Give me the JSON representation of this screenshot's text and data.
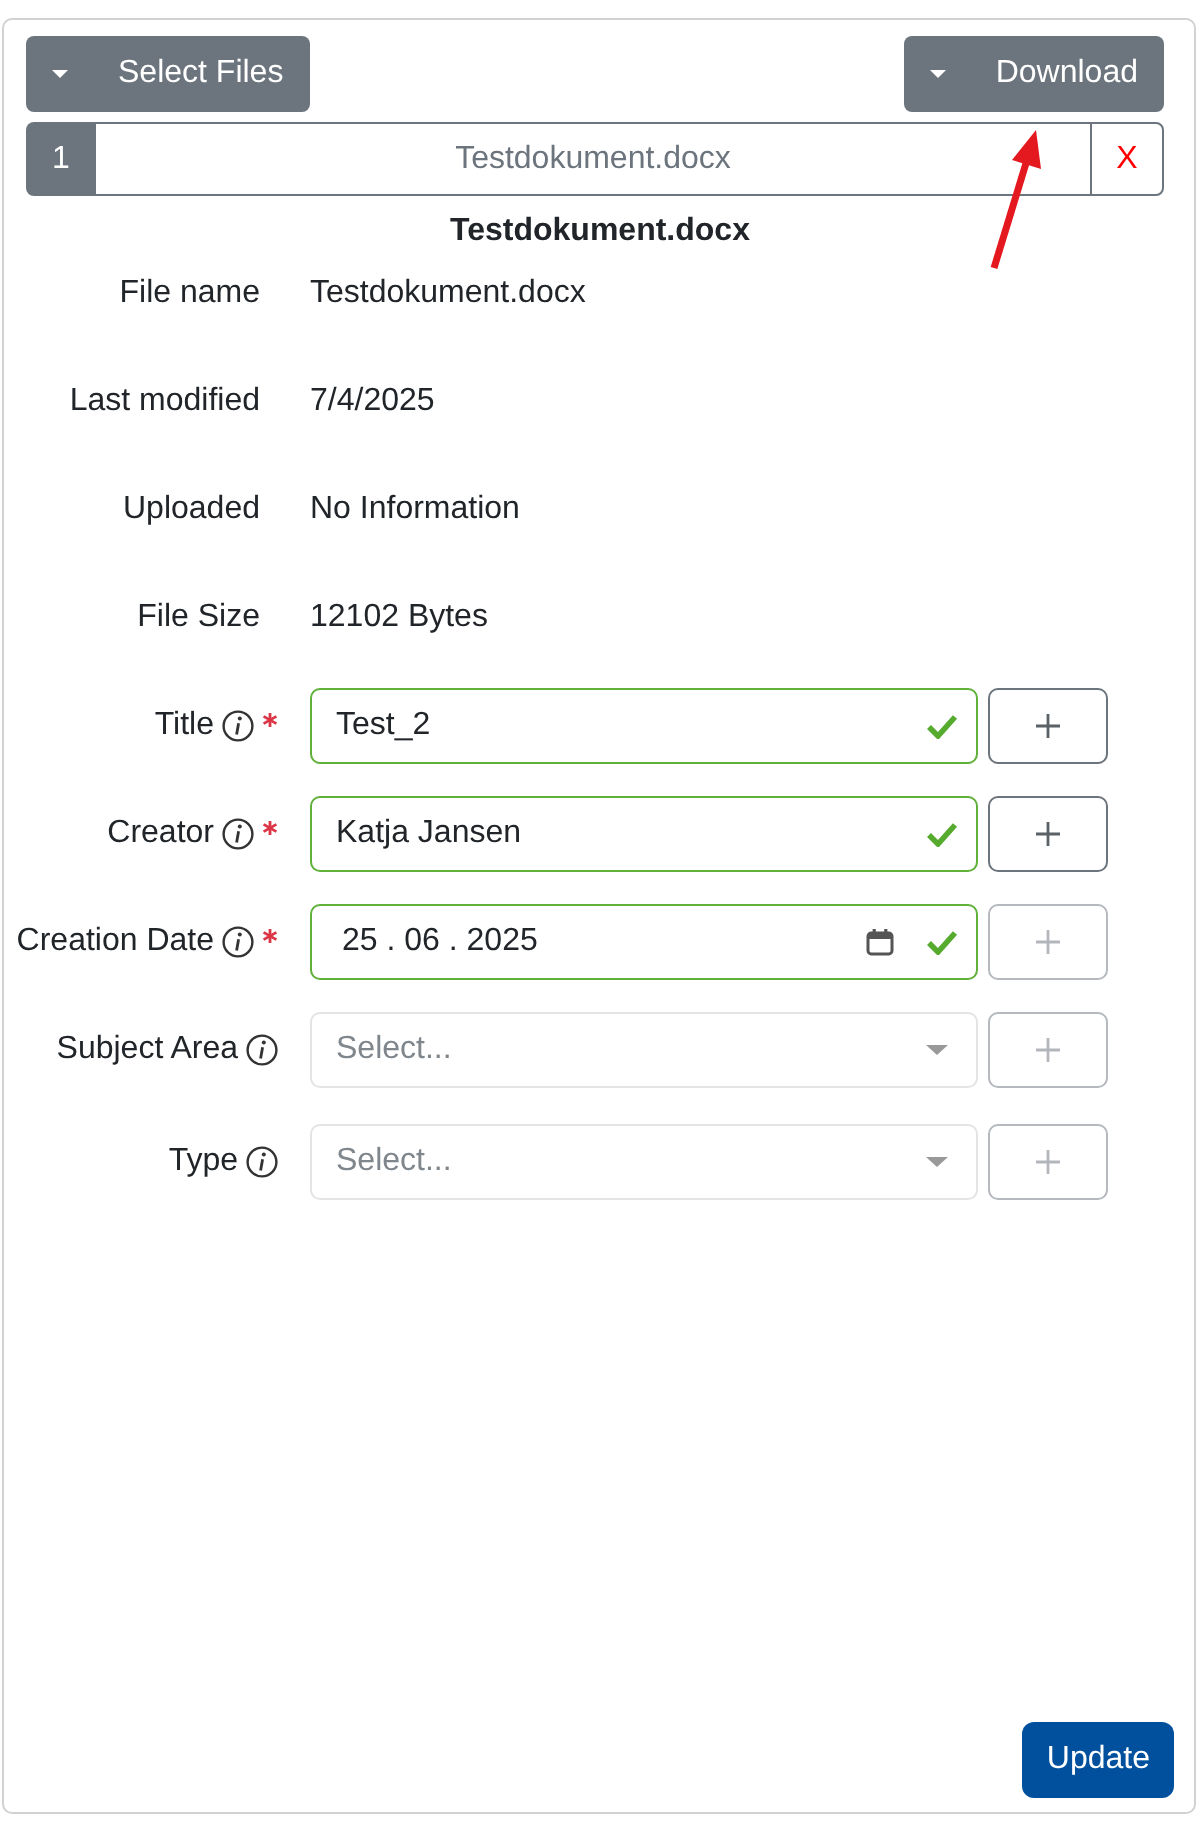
{
  "toolbar": [
    {
      "label": "Select Files"
    },
    {
      "label": "Download"
    }
  ],
  "files": [
    {
      "number": "1",
      "name": "Testdokument.docx",
      "remove": "X"
    }
  ],
  "heading": "Testdokument.docx",
  "details": [
    {
      "label": "File name",
      "value": "Testdokument.docx"
    },
    {
      "label": "Last modified",
      "value": "7/4/2025"
    },
    {
      "label": "Uploaded",
      "value": "No Information"
    },
    {
      "label": "File Size",
      "value": "12102 Bytes"
    }
  ],
  "fields": [
    {
      "label": "Title",
      "kind": "text",
      "value": "Test_2",
      "required": true,
      "valid": true,
      "add_disabled": false
    },
    {
      "label": "Creator",
      "kind": "text",
      "value": "Katja Jansen",
      "required": true,
      "valid": true,
      "add_disabled": false
    },
    {
      "label": "Creation Date",
      "kind": "date",
      "value": "25 . 06 . 2025",
      "required": true,
      "valid": true,
      "add_disabled": true
    },
    {
      "label": "Subject Area",
      "kind": "select",
      "placeholder": "Select...",
      "required": false,
      "valid": false,
      "add_disabled": true
    },
    {
      "label": "Type",
      "kind": "select",
      "placeholder": "Select...",
      "required": false,
      "valid": false,
      "add_disabled": true
    }
  ],
  "submit": "Update",
  "annotation_arrow": true
}
